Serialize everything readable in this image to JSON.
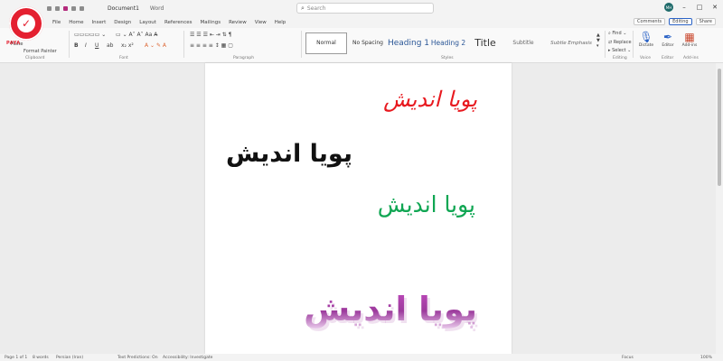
{
  "titlebar": {
    "doc_title": "Document1",
    "app_name": "Word",
    "search_placeholder": "Search",
    "avatar_initials": "MH",
    "share_label": "Share"
  },
  "menu": {
    "items": [
      "File",
      "Home",
      "Insert",
      "Design",
      "Layout",
      "References",
      "Mailings",
      "Review",
      "View",
      "Help"
    ],
    "editing_label": "Editing",
    "comments_label": "Comments"
  },
  "ribbon": {
    "paste_label": "Paste",
    "clipboard_label": "Clipboard",
    "format_painter_label": "Format Painter",
    "font_label": "Font",
    "paragraph_label": "Paragraph",
    "styles_label": "Styles",
    "editing_group_label": "Editing",
    "find_label": "Find",
    "replace_label": "Replace",
    "select_label": "Select",
    "dictate_label": "Dictate",
    "voice_label": "Voice",
    "editor_label": "Editor",
    "addins_label": "Add-ins",
    "styles": [
      "Normal",
      "No Spacing",
      "Heading 1",
      "Heading 2",
      "Title",
      "Subtitle",
      "Subtle Emphasis"
    ]
  },
  "logo": {
    "text": "PAYA"
  },
  "document": {
    "line1": "پویا اندیش",
    "line2": "پویا اندیش",
    "line3": "پویا اندیش",
    "line4": "پویا اندیش"
  },
  "status": {
    "page": "Page 1 of 1",
    "words": "8 words",
    "language": "Persian (Iran)",
    "predictions": "Text Predictions: On",
    "accessibility": "Accessibility: Investigate",
    "focus": "Focus",
    "zoom": "100%"
  },
  "colors": {
    "red": "#e8191f",
    "green": "#10a653",
    "purple": "#b044ad",
    "brand_red": "#e42030"
  }
}
